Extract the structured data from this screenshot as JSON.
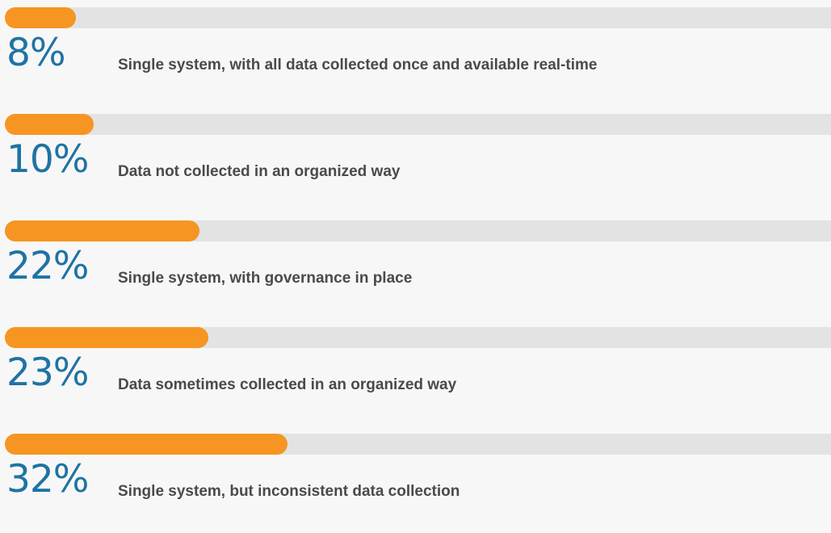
{
  "chart_data": {
    "type": "bar",
    "orientation": "horizontal",
    "ylim": [
      0,
      100
    ],
    "bar_color": "#f69522",
    "track_color": "#e3e3e3",
    "value_label_color": "#1f73a3",
    "items": [
      {
        "value": 8,
        "value_label": "8%",
        "label": "Single system, with all data collected once and available real-time"
      },
      {
        "value": 10,
        "value_label": "10%",
        "label": "Data not collected in an organized way"
      },
      {
        "value": 22,
        "value_label": "22%",
        "label": "Single system, with governance in place"
      },
      {
        "value": 23,
        "value_label": "23%",
        "label": "Data sometimes collected in an organized way"
      },
      {
        "value": 32,
        "value_label": "32%",
        "label": "Single system, but inconsistent data collection"
      }
    ]
  }
}
